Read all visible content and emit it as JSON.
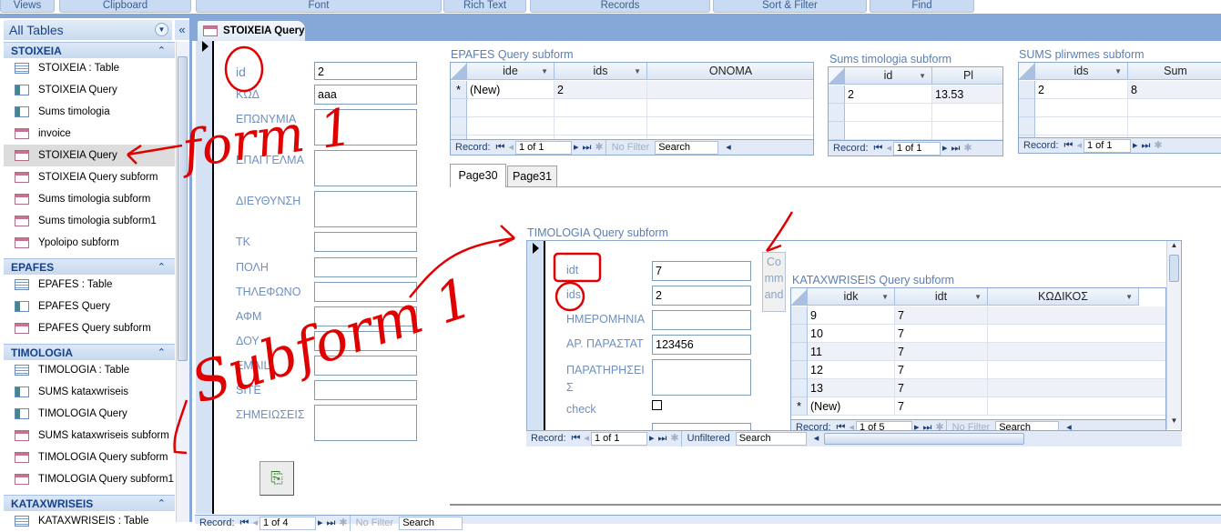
{
  "ribbon": {
    "groups": [
      "Views",
      "Clipboard",
      "Font",
      "Rich Text",
      "Records",
      "Sort & Filter",
      "Find"
    ]
  },
  "nav": {
    "title": "All Tables",
    "groups": [
      {
        "name": "STOIXEIA",
        "items": [
          {
            "label": "STOIXEIA : Table",
            "icon": "table"
          },
          {
            "label": "STOIXEIA Query",
            "icon": "query"
          },
          {
            "label": "Sums timologia",
            "icon": "query"
          },
          {
            "label": "invoice",
            "icon": "form"
          },
          {
            "label": "STOIXEIA Query",
            "icon": "form",
            "selected": true
          },
          {
            "label": "STOIXEIA Query subform",
            "icon": "form"
          },
          {
            "label": "Sums timologia subform",
            "icon": "form"
          },
          {
            "label": "Sums timologia subform1",
            "icon": "form"
          },
          {
            "label": "Ypoloipo subform",
            "icon": "form"
          }
        ]
      },
      {
        "name": "EPAFES",
        "items": [
          {
            "label": "EPAFES : Table",
            "icon": "table"
          },
          {
            "label": "EPAFES Query",
            "icon": "query"
          },
          {
            "label": "EPAFES Query subform",
            "icon": "form"
          }
        ]
      },
      {
        "name": "TIMOLOGIA",
        "items": [
          {
            "label": "TIMOLOGIA : Table",
            "icon": "table"
          },
          {
            "label": "SUMS kataxwriseis",
            "icon": "query"
          },
          {
            "label": "TIMOLOGIA Query",
            "icon": "query"
          },
          {
            "label": "SUMS kataxwriseis subform",
            "icon": "form"
          },
          {
            "label": "TIMOLOGIA Query subform",
            "icon": "form"
          },
          {
            "label": "TIMOLOGIA Query subform1",
            "icon": "form"
          }
        ]
      },
      {
        "name": "KATAXWRISEIS",
        "items": [
          {
            "label": "KATAXWRISEIS : Table",
            "icon": "table"
          }
        ]
      }
    ]
  },
  "doc_tab": "STOIXEIA Query",
  "main_form": {
    "fields": [
      {
        "label": "id",
        "value": "2"
      },
      {
        "label": "ΚΩΔ",
        "value": "aaa"
      },
      {
        "label": "ΕΠΩΝΥΜΙΑ",
        "value": ""
      },
      {
        "label": "ΕΠΑΓΓΕΛΜΑ",
        "value": ""
      },
      {
        "label": "ΔΙΕΥΘΥΝΣΗ",
        "value": ""
      },
      {
        "label": "ΤΚ",
        "value": ""
      },
      {
        "label": "ΠΟΛΗ",
        "value": ""
      },
      {
        "label": "ΤΗΛΕΦΩΝΟ",
        "value": ""
      },
      {
        "label": "ΑΦΜ",
        "value": ""
      },
      {
        "label": "ΔΟΥ",
        "value": ""
      },
      {
        "label": "EMAIL",
        "value": ""
      },
      {
        "label": "SITE",
        "value": ""
      },
      {
        "label": "ΣΗΜΕΙΩΣΕΙΣ",
        "value": ""
      }
    ],
    "record_nav": {
      "label": "Record:",
      "position": "1 of 4",
      "filter": "No Filter",
      "search": "Search"
    }
  },
  "epafes": {
    "title": "EPAFES Query subform",
    "columns": [
      "ide",
      "ids",
      "ONOMA"
    ],
    "rows": [
      {
        "marker": "*",
        "cells": [
          "(New)",
          "2",
          ""
        ]
      }
    ],
    "record_nav": {
      "label": "Record:",
      "position": "1 of 1",
      "filter": "No Filter",
      "search": "Search"
    }
  },
  "sums_timologia": {
    "title": "Sums timologia subform",
    "columns": [
      "id",
      "Pl"
    ],
    "rows": [
      {
        "marker": "",
        "cells": [
          "2",
          "13.53"
        ]
      }
    ],
    "record_nav": {
      "label": "Record:",
      "position": "1 of 1"
    }
  },
  "sums_plirwmes": {
    "title": "SUMS plirwmes subform",
    "columns": [
      "ids",
      "Sum"
    ],
    "rows": [
      {
        "marker": "",
        "cells": [
          "2",
          "8"
        ]
      }
    ],
    "record_nav": {
      "label": "Record:",
      "position": "1 of 1"
    }
  },
  "tabs": [
    "Page30",
    "Page31"
  ],
  "timologia": {
    "title": "TIMOLOGIA Query subform",
    "fields": [
      {
        "label": "idt",
        "value": "7"
      },
      {
        "label": "ids",
        "value": "2"
      },
      {
        "label": "ΗΜΕΡΟΜΗΝΙΑ",
        "value": ""
      },
      {
        "label": "ΑΡ. ΠΑΡΑΣΤΑΤ",
        "value": "123456"
      },
      {
        "label": "ΠΑΡΑΤΗΡΗΣΕΙ Σ",
        "value": ""
      }
    ],
    "check_label": "check",
    "command_button": "Command",
    "record_nav": {
      "label": "Record:",
      "position": "1 of 1",
      "filter": "Unfiltered",
      "search": "Search"
    }
  },
  "kataxwriseis": {
    "title": "KATAXWRISEIS Query subform",
    "columns": [
      "idk",
      "idt",
      "ΚΩΔΙΚΟΣ"
    ],
    "rows": [
      {
        "marker": "",
        "cells": [
          "9",
          "7",
          ""
        ]
      },
      {
        "marker": "",
        "cells": [
          "10",
          "7",
          ""
        ]
      },
      {
        "marker": "",
        "cells": [
          "11",
          "7",
          ""
        ]
      },
      {
        "marker": "",
        "cells": [
          "12",
          "7",
          ""
        ]
      },
      {
        "marker": "",
        "cells": [
          "13",
          "7",
          ""
        ]
      },
      {
        "marker": "*",
        "cells": [
          "(New)",
          "7",
          ""
        ]
      }
    ],
    "record_nav": {
      "label": "Record:",
      "position": "1 of 5",
      "filter": "No Filter",
      "search": "Search"
    }
  },
  "annotations": {
    "form": "form 1",
    "subform": "Subform 1"
  },
  "colors": {
    "accent": "#86a8d8",
    "annotation": "#e00000",
    "label": "#6f8fbf"
  }
}
